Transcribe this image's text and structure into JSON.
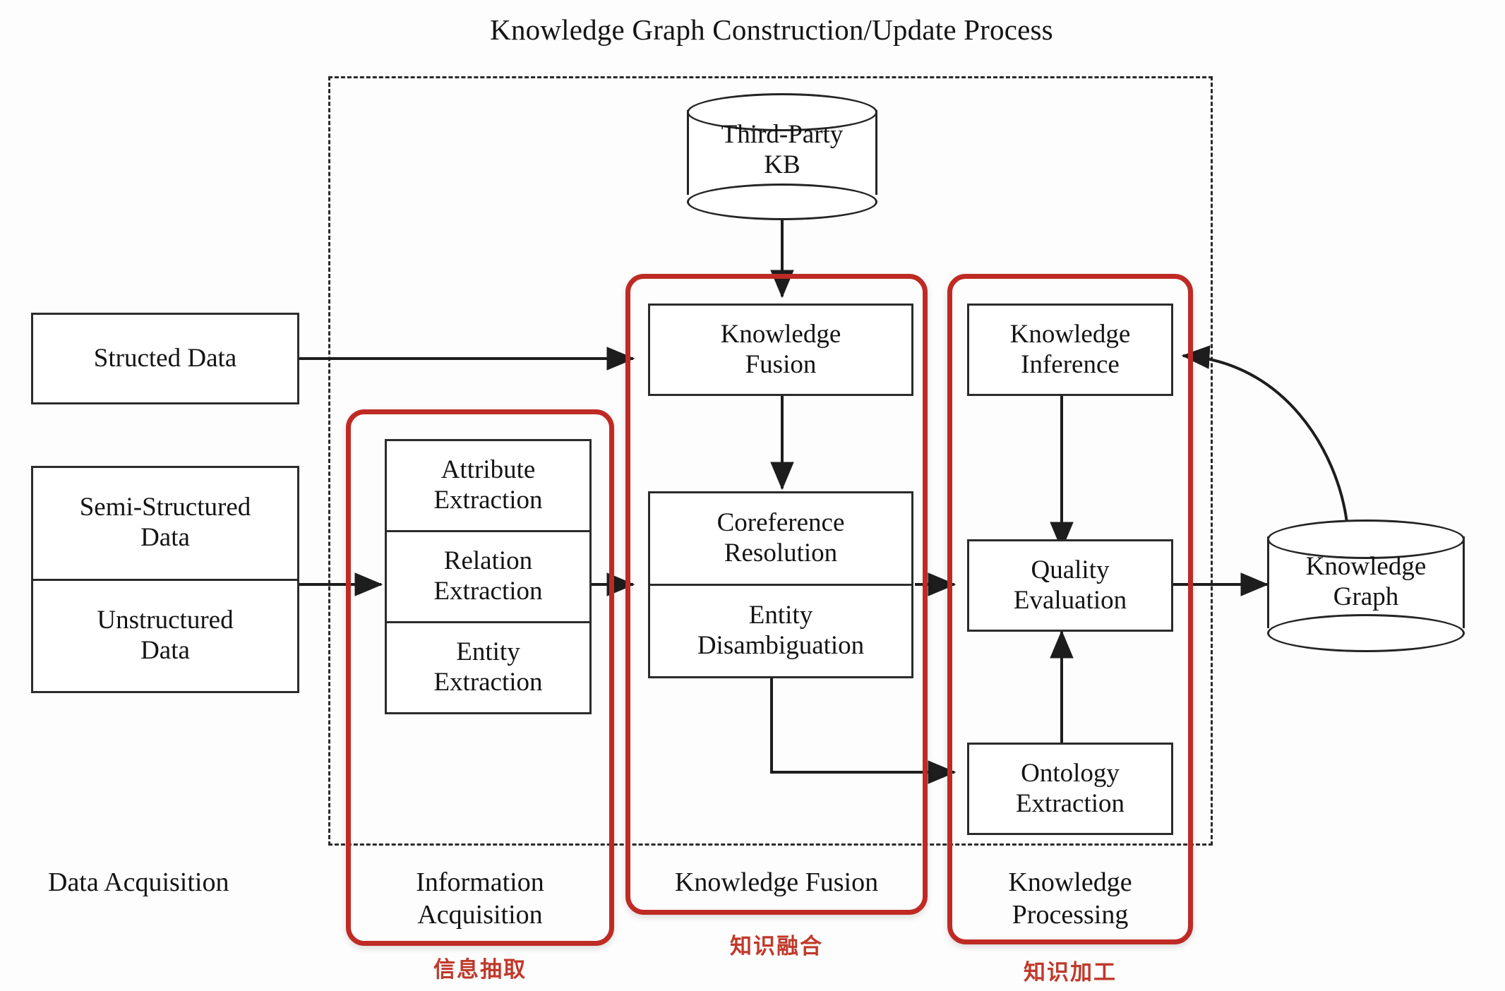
{
  "title": "Knowledge Graph Construction/Update Process",
  "sources": {
    "structured": "Structed Data",
    "semi_structured": "Semi-Structured\nData",
    "unstructured": "Unstructured\nData"
  },
  "third_party_kb": "Third-Party\nKB",
  "knowledge_graph": "Knowledge\nGraph",
  "information_acquisition": {
    "items": [
      "Attribute\nExtraction",
      "Relation\nExtraction",
      "Entity\nExtraction"
    ]
  },
  "knowledge_fusion": {
    "fusion": "Knowledge\nFusion",
    "items": [
      "Coreference\nResolution",
      "Entity\nDisambiguation"
    ]
  },
  "knowledge_processing": {
    "inference": "Knowledge\nInference",
    "quality": "Quality\nEvaluation",
    "ontology": "Ontology\nExtraction"
  },
  "captions": {
    "data_acquisition": "Data Acquisition",
    "information_acquisition": "Information\nAcquisition",
    "knowledge_fusion": "Knowledge Fusion",
    "knowledge_processing": "Knowledge\nProcessing",
    "cn_information_acquisition": "信息抽取",
    "cn_knowledge_fusion": "知识融合",
    "cn_knowledge_processing": "知识加工"
  },
  "colors": {
    "phase_border": "#bf2a24",
    "cn_text": "#c0392b",
    "node_border": "#2b2b2b",
    "dashed_border": "#2a2a2a"
  }
}
